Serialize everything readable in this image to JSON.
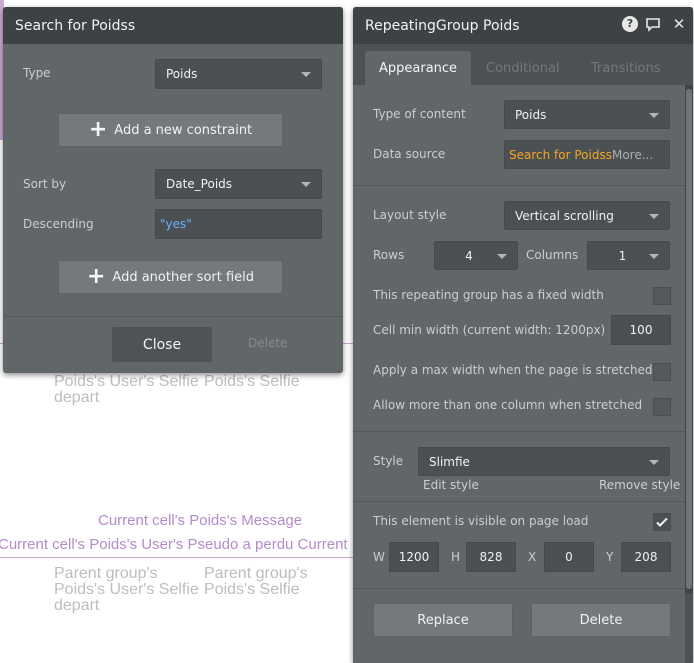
{
  "background": {
    "row1": {
      "col1_lines": [
        "Poids's User's Selfie",
        "depart"
      ],
      "col2_lines": [
        "Poids's Selfie"
      ]
    },
    "message": "Current cell's Poids's Message",
    "pseudo_line": "Current cell's Poids's User's Pseudo a perdu Current",
    "row2": {
      "col1_lines": [
        "Parent group's",
        "Poids's User's Selfie",
        "depart"
      ],
      "col2_lines": [
        "Parent group's",
        "Poids's Selfie"
      ]
    }
  },
  "search_panel": {
    "title": "Search for Poidss",
    "type_label": "Type",
    "type_value": "Poids",
    "add_constraint_label": "Add a new constraint",
    "sort_by_label": "Sort by",
    "sort_by_value": "Date_Poids",
    "descending_label": "Descending",
    "descending_value": "\"yes\"",
    "add_sort_label": "Add another sort field",
    "close_label": "Close",
    "delete_label": "Delete"
  },
  "editor": {
    "title": "RepeatingGroup Poids",
    "header_icons": [
      "help-icon",
      "comment-icon",
      "close-icon"
    ],
    "tabs": [
      "Appearance",
      "Conditional",
      "Transitions"
    ],
    "active_tab": "Appearance",
    "type_of_content_label": "Type of content",
    "type_of_content_value": "Poids",
    "data_source_label": "Data source",
    "data_source_value": "Search for Poidss",
    "data_source_more": "More...",
    "layout_style_label": "Layout style",
    "layout_style_value": "Vertical scrolling",
    "rows_label": "Rows",
    "rows_value": "4",
    "columns_label": "Columns",
    "columns_value": "1",
    "fixed_width_label": "This repeating group has a fixed width",
    "cell_min_width_label": "Cell min width (current width: 1200px)",
    "cell_min_width_value": "100",
    "max_width_label": "Apply a max width when the page is stretched",
    "multi_column_label": "Allow more than one column when stretched",
    "style_label": "Style",
    "style_value": "Slimfie",
    "edit_style_label": "Edit style",
    "remove_style_label": "Remove style",
    "visible_label": "This element is visible on page load",
    "visible_checked": true,
    "w_label": "W",
    "w_value": "1200",
    "h_label": "H",
    "h_value": "828",
    "x_label": "X",
    "x_value": "0",
    "y_label": "Y",
    "y_value": "208",
    "replace_label": "Replace",
    "delete_label": "Delete"
  },
  "colors": {
    "panel_dark": "#3d4245",
    "panel_body": "#616669",
    "accent_orange": "#f5a623",
    "accent_blue": "#6ab0ff",
    "canvas_purple": "#b58bc8"
  }
}
